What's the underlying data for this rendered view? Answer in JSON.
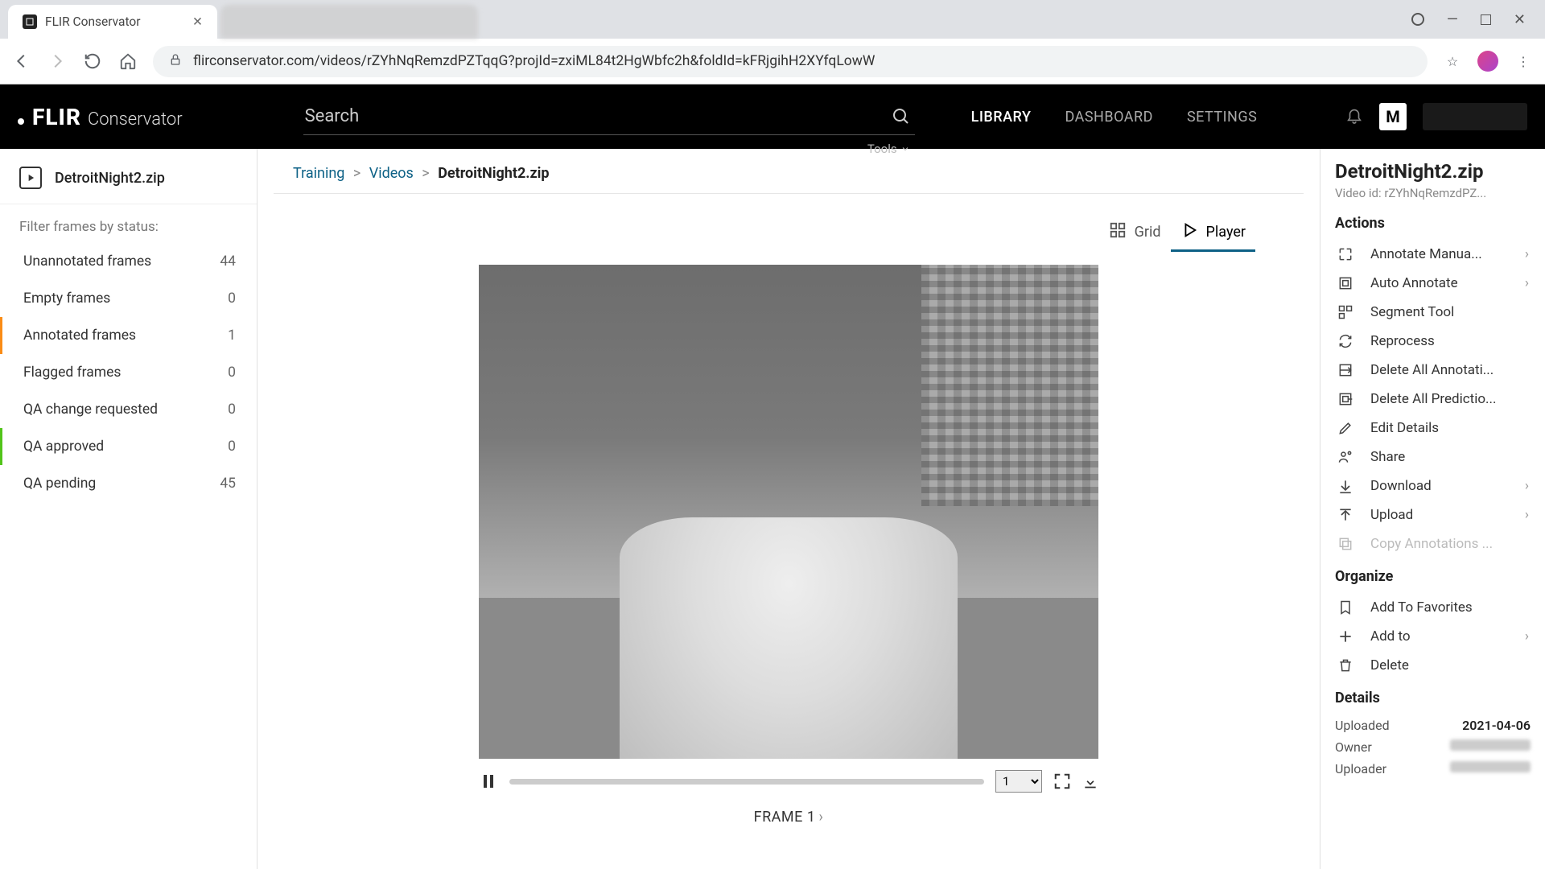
{
  "browser": {
    "tab_title": "FLIR Conservator",
    "url": "flirconservator.com/videos/rZYhNqRemzdPZTqqG?projId=zxiML84t2HgWbfc2h&foldId=kFRjgihH2XYfqLowW"
  },
  "header": {
    "logo_mark": "FLIR",
    "logo_sub": "Conservator",
    "search_placeholder": "Search",
    "tools_label": "Tools",
    "nav": {
      "library": "LIBRARY",
      "dashboard": "DASHBOARD",
      "settings": "SETTINGS"
    },
    "user_initial": "M"
  },
  "sidebar": {
    "file_name": "DetroitNight2.zip",
    "filter_label": "Filter frames by status:",
    "filters": [
      {
        "label": "Unannotated frames",
        "count": "44"
      },
      {
        "label": "Empty frames",
        "count": "0"
      },
      {
        "label": "Annotated frames",
        "count": "1"
      },
      {
        "label": "Flagged frames",
        "count": "0"
      },
      {
        "label": "QA change requested",
        "count": "0"
      },
      {
        "label": "QA approved",
        "count": "0"
      },
      {
        "label": "QA pending",
        "count": "45"
      }
    ]
  },
  "breadcrumb": {
    "c0": "Training",
    "c1": "Videos",
    "c2": "DetroitNight2.zip"
  },
  "view": {
    "grid": "Grid",
    "player": "Player"
  },
  "player": {
    "speed": "1",
    "frame_label": "FRAME 1"
  },
  "right": {
    "title": "DetroitNight2.zip",
    "video_id_label": "Video id: rZYhNqRemzdPZ...",
    "actions_heading": "Actions",
    "actions": {
      "annotate_manual": "Annotate Manua...",
      "auto_annotate": "Auto Annotate",
      "segment_tool": "Segment Tool",
      "reprocess": "Reprocess",
      "delete_annotations": "Delete All Annotati...",
      "delete_predictions": "Delete All Predictio...",
      "edit_details": "Edit Details",
      "share": "Share",
      "download": "Download",
      "upload": "Upload",
      "copy_annotations": "Copy Annotations ..."
    },
    "organize_heading": "Organize",
    "organize": {
      "favorites": "Add To Favorites",
      "add_to": "Add to",
      "delete": "Delete"
    },
    "details_heading": "Details",
    "details": {
      "uploaded_label": "Uploaded",
      "uploaded_value": "2021-04-06",
      "owner_label": "Owner",
      "uploader_label": "Uploader"
    }
  }
}
